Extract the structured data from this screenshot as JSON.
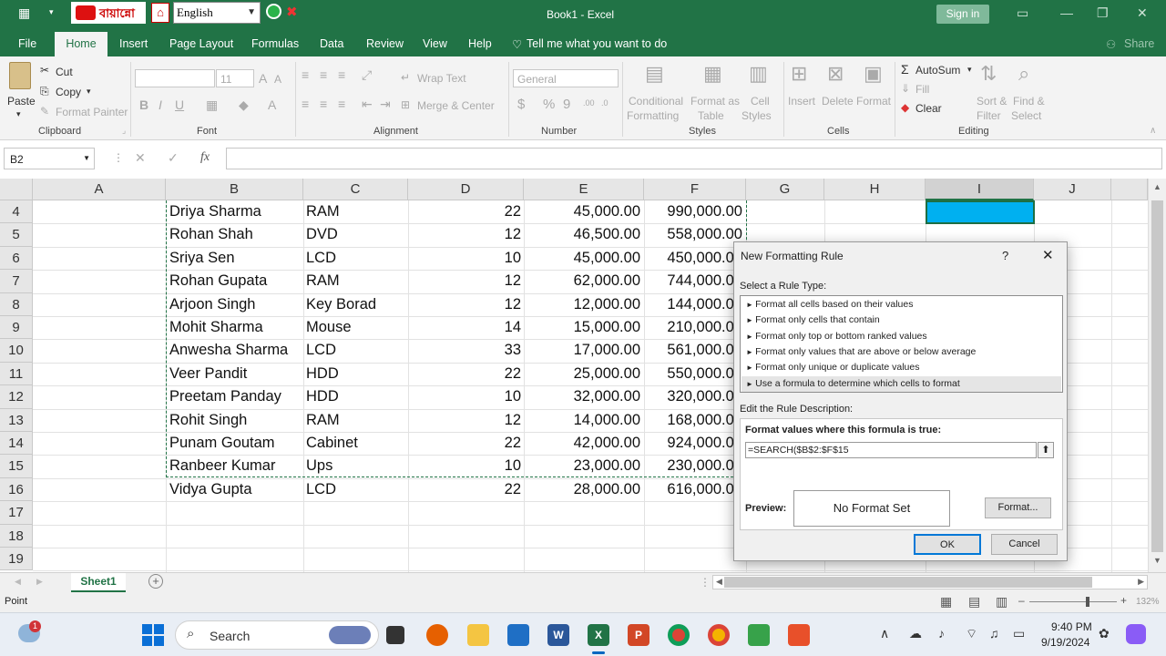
{
  "window": {
    "title": "Book1  -  Excel",
    "signin": "Sign in",
    "share": "Share"
  },
  "qat": {
    "language": "English",
    "brand_text": "বায়ান্নো"
  },
  "menu": {
    "tabs": [
      "File",
      "Home",
      "Insert",
      "Page Layout",
      "Formulas",
      "Data",
      "Review",
      "View",
      "Help"
    ],
    "tell_me": "Tell me what you want to do"
  },
  "ribbon": {
    "clipboard": {
      "paste": "Paste",
      "cut": "Cut",
      "copy": "Copy",
      "format_painter": "Format Painter",
      "group": "Clipboard"
    },
    "font": {
      "size": "11",
      "group": "Font"
    },
    "alignment": {
      "wrap": "Wrap Text",
      "merge": "Merge & Center",
      "group": "Alignment"
    },
    "number": {
      "format": "General",
      "group": "Number"
    },
    "styles": {
      "cond1": "Conditional",
      "cond2": "Formatting",
      "fmt1": "Format as",
      "fmt2": "Table",
      "cell1": "Cell",
      "cell2": "Styles",
      "group": "Styles"
    },
    "cells": {
      "insert": "Insert",
      "delete": "Delete",
      "format": "Format",
      "group": "Cells"
    },
    "editing": {
      "autosum": "AutoSum",
      "fill": "Fill",
      "clear": "Clear",
      "sort1": "Sort &",
      "sort2": "Filter",
      "find1": "Find &",
      "find2": "Select",
      "group": "Editing"
    }
  },
  "formula_bar": {
    "name_box": "B2",
    "fx": "fx",
    "value": ""
  },
  "columns": [
    "A",
    "B",
    "C",
    "D",
    "E",
    "F",
    "G",
    "H",
    "I",
    "J"
  ],
  "rows": [
    {
      "num": "4",
      "b": "Driya Sharma",
      "c": "RAM",
      "d": "22",
      "e": "45,000.00",
      "f": "990,000.00"
    },
    {
      "num": "5",
      "b": "Rohan Shah",
      "c": "DVD",
      "d": "12",
      "e": "46,500.00",
      "f": "558,000.00"
    },
    {
      "num": "6",
      "b": "Sriya Sen",
      "c": "LCD",
      "d": "10",
      "e": "45,000.00",
      "f": "450,000.00"
    },
    {
      "num": "7",
      "b": "Rohan Gupata",
      "c": "RAM",
      "d": "12",
      "e": "62,000.00",
      "f": "744,000.00"
    },
    {
      "num": "8",
      "b": "Arjoon Singh",
      "c": "Key Borad",
      "d": "12",
      "e": "12,000.00",
      "f": "144,000.00"
    },
    {
      "num": "9",
      "b": "Mohit Sharma",
      "c": "Mouse",
      "d": "14",
      "e": "15,000.00",
      "f": "210,000.00"
    },
    {
      "num": "10",
      "b": "Anwesha Sharma",
      "c": " LCD",
      "d": "33",
      "e": "17,000.00",
      "f": "561,000.00"
    },
    {
      "num": "11",
      "b": "Veer Pandit",
      "c": "HDD",
      "d": "22",
      "e": "25,000.00",
      "f": "550,000.00"
    },
    {
      "num": "12",
      "b": "Preetam Panday",
      "c": "HDD",
      "d": "10",
      "e": "32,000.00",
      "f": "320,000.00"
    },
    {
      "num": "13",
      "b": "Rohit Singh",
      "c": "RAM",
      "d": "12",
      "e": "14,000.00",
      "f": "168,000.00"
    },
    {
      "num": "14",
      "b": "Punam Goutam",
      "c": "Cabinet",
      "d": "22",
      "e": "42,000.00",
      "f": "924,000.00"
    },
    {
      "num": "15",
      "b": "Ranbeer Kumar",
      "c": "Ups",
      "d": "10",
      "e": "23,000.00",
      "f": "230,000.00"
    },
    {
      "num": "16",
      "b": "Vidya Gupta",
      "c": "LCD",
      "d": "22",
      "e": "28,000.00",
      "f": "616,000.00"
    },
    {
      "num": "17",
      "b": "",
      "c": "",
      "d": "",
      "e": "",
      "f": ""
    },
    {
      "num": "18",
      "b": "",
      "c": "",
      "d": "",
      "e": "",
      "f": ""
    },
    {
      "num": "19",
      "b": "",
      "c": "",
      "d": "",
      "e": "",
      "f": ""
    }
  ],
  "dialog": {
    "title": "New Formatting Rule",
    "help": "?",
    "select_label": "Select a Rule Type:",
    "rule_types": [
      "Format all cells based on their values",
      "Format only cells that contain",
      "Format only top or bottom ranked values",
      "Format only values that are above or below average",
      "Format only unique or duplicate values",
      "Use a formula to determine which cells to format"
    ],
    "edit_label": "Edit the Rule Description:",
    "formula_label": "Format values where this formula is true:",
    "formula": "=SEARCH($B$2:$F$15",
    "preview_label": "Preview:",
    "preview_text": "No Format Set",
    "format_button": "Format...",
    "ok": "OK",
    "cancel": "Cancel"
  },
  "sheet": {
    "tab": "Sheet1"
  },
  "status": {
    "mode": "Point",
    "zoom": "132%"
  },
  "taskbar": {
    "search": "Search",
    "time": "9:40 PM",
    "date": "9/19/2024",
    "badge": "1"
  },
  "colors": {
    "excel_green": "#217346",
    "selected_fill": "#00b0f0"
  }
}
